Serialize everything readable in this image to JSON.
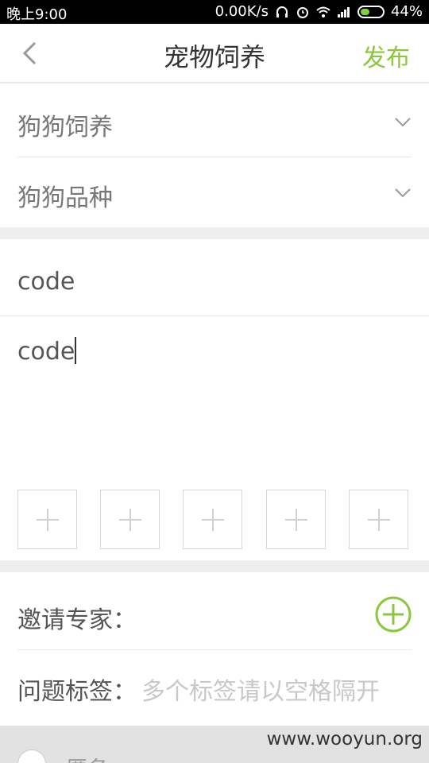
{
  "status_bar": {
    "time": "晚上9:00",
    "speed": "0.00K/s",
    "battery": "44%",
    "battery_level": 0.44
  },
  "header": {
    "title": "宠物饲养",
    "publish_label": "发布",
    "accent_color": "#8cc63f"
  },
  "selectors": {
    "category": {
      "label": "狗狗饲养"
    },
    "breed": {
      "label": "狗狗品种"
    }
  },
  "form": {
    "title_value": "code",
    "content_value": "code"
  },
  "photos": {
    "add_icon": "plus-icon"
  },
  "invite": {
    "label": "邀请专家：",
    "icon": "add-circle-icon"
  },
  "tags": {
    "label": "问题标签：",
    "placeholder": "多个标签请以空格隔开"
  },
  "footer": {
    "anonymous_label": "匿名",
    "watermark": "www.wooyun.org"
  }
}
